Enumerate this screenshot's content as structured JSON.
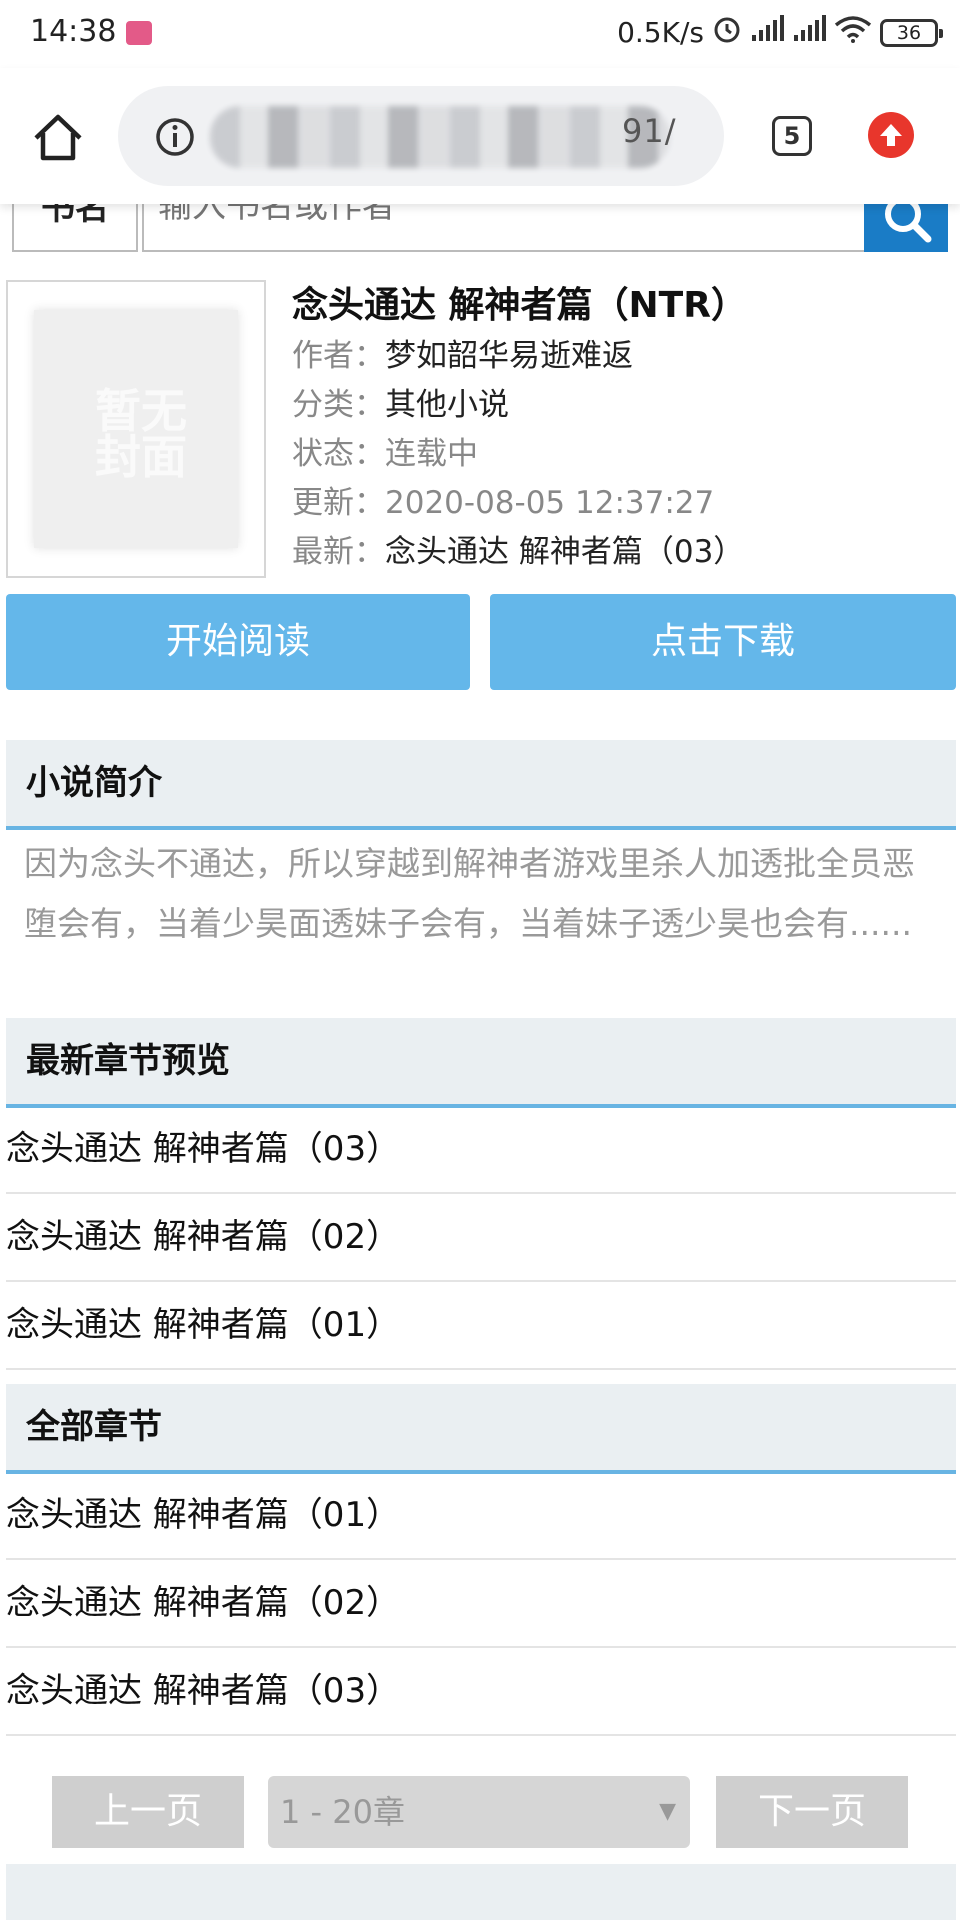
{
  "status_bar": {
    "time": "14:38",
    "network_speed": "0.5K/s",
    "battery": "36"
  },
  "browser": {
    "url_visible_suffix": "91/",
    "tab_count": "5"
  },
  "search": {
    "label": "书名",
    "placeholder": "输入书名或作者"
  },
  "book": {
    "cover_placeholder": "暂无封面",
    "title": "念头通达 解神者篇（NTR）",
    "author_key": "作者：",
    "author": "梦如韶华易逝难返",
    "category_key": "分类：",
    "category": "其他小说",
    "status_key": "状态：",
    "status": "连载中",
    "updated_key": "更新：",
    "updated": "2020-08-05 12:37:27",
    "latest_key": "最新：",
    "latest": "念头通达 解神者篇（03）"
  },
  "actions": {
    "read_label": "开始阅读",
    "download_label": "点击下载"
  },
  "intro": {
    "header": "小说简介",
    "text": "因为念头不通达，所以穿越到解神者游戏里杀人加透批全员恶堕会有，当着少昊面透妹子会有，当着妹子透少昊也会有......"
  },
  "latest_chapters": {
    "header": "最新章节预览",
    "items": [
      "念头通达 解神者篇（03）",
      "念头通达 解神者篇（02）",
      "念头通达 解神者篇（01）"
    ]
  },
  "all_chapters": {
    "header": "全部章节",
    "items": [
      "念头通达 解神者篇（01）",
      "念头通达 解神者篇（02）",
      "念头通达 解神者篇（03）"
    ]
  },
  "pager": {
    "prev_label": "上一页",
    "select_value": "1 - 20章",
    "next_label": "下一页"
  },
  "colors": {
    "accent_blue": "#64b7ea",
    "section_bg": "#eaeff2",
    "section_border": "#68b4e3",
    "search_button": "#1a7cc6",
    "update_icon": "#e8362c"
  }
}
